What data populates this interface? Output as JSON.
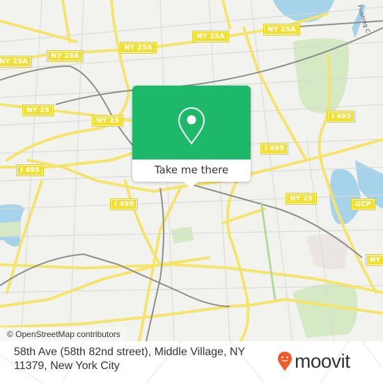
{
  "map": {
    "attribution": "© OpenStreetMap contributors",
    "route_shields": [
      {
        "label": "NY 25A",
        "id": "ny25a-west-edge"
      },
      {
        "label": "NY 25A",
        "id": "ny25a-1"
      },
      {
        "label": "NY 25A",
        "id": "ny25a-2"
      },
      {
        "label": "NY 25A",
        "id": "ny25a-3"
      },
      {
        "label": "NY 25A",
        "id": "ny25a-4"
      },
      {
        "label": "NY 25",
        "id": "ny25-1"
      },
      {
        "label": "NY 25",
        "id": "ny25-2"
      },
      {
        "label": "NY 25",
        "id": "ny25-3"
      },
      {
        "label": "NY",
        "id": "ny-edge"
      },
      {
        "label": "I 495",
        "id": "i495-1"
      },
      {
        "label": "I 495",
        "id": "i495-2"
      },
      {
        "label": "I 495",
        "id": "i495-3"
      },
      {
        "label": "I 495",
        "id": "i495-4"
      },
      {
        "label": "GCP",
        "id": "gcp"
      }
    ],
    "water_label": "Flushing C"
  },
  "popup": {
    "icon": "map-pin-icon",
    "button_label": "Take me there",
    "accent_color": "#1db86a"
  },
  "footer": {
    "address": "58th Ave (58th 82nd street), Middle Village, NY 11379, New York City",
    "brand": "moovit",
    "brand_icon": "moovit-pin-icon",
    "brand_color": "#f15a29"
  }
}
